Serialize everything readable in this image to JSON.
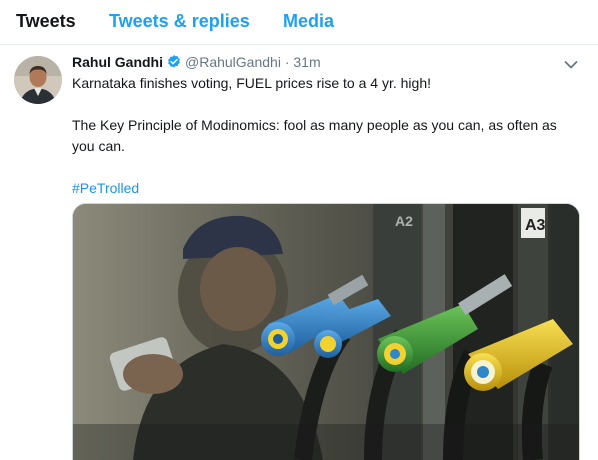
{
  "tabs": [
    {
      "label": "Tweets",
      "active": true
    },
    {
      "label": "Tweets & replies",
      "active": false
    },
    {
      "label": "Media",
      "active": false
    }
  ],
  "tweet": {
    "author_name": "Rahul Gandhi",
    "author_handle": "@RahulGandhi",
    "separator": "·",
    "time": "31m",
    "verified": true,
    "line1": "Karnataka finishes voting, FUEL prices rise to a 4 yr. high!",
    "line2": "The Key Principle of Modinomics: fool as many people as you can, as often as you can.",
    "hashtag": "#PeTrolled",
    "media": {
      "pump_labels": [
        "A2",
        "A3"
      ],
      "alt": "photo of fuel pump nozzles"
    }
  },
  "colors": {
    "accent": "#1da1f2",
    "text": "#14171a",
    "muted": "#657786",
    "link": "#1b95e0",
    "nozzle_blue": "#2f86c9",
    "nozzle_green": "#3aa037",
    "nozzle_yellow": "#e8c21c"
  },
  "icons": [
    "verified-badge-icon",
    "chevron-down-icon"
  ]
}
